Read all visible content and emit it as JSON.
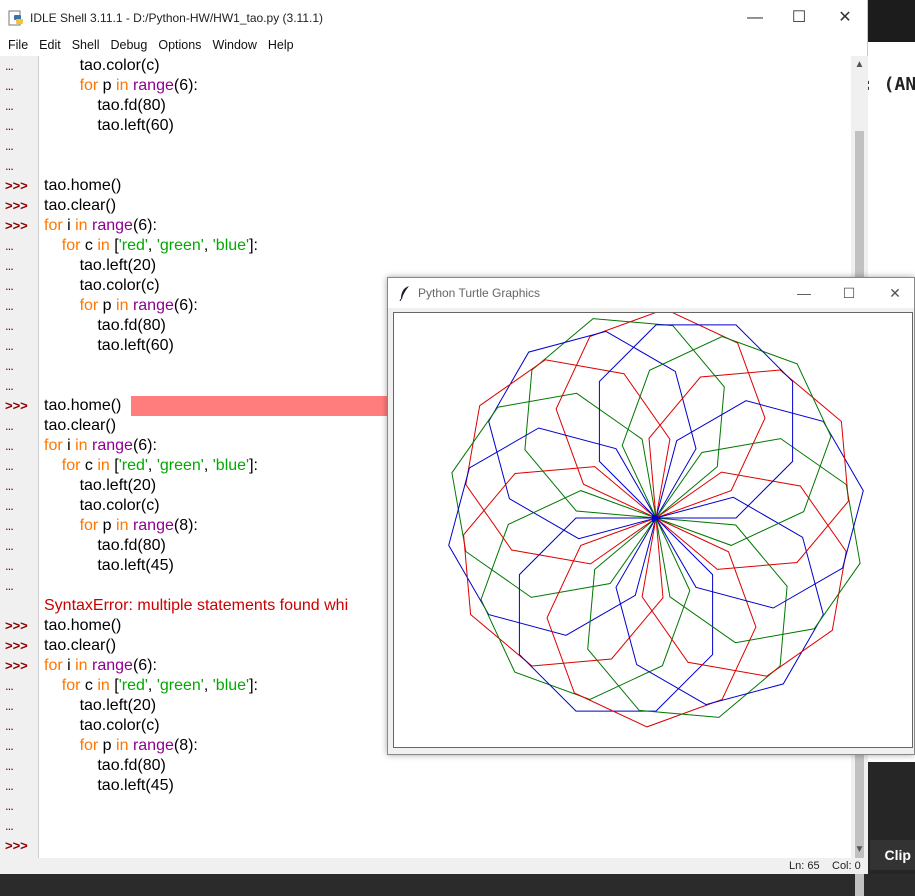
{
  "background": {
    "partial_code_text": ": (AN",
    "clip_button": "Clip"
  },
  "idle": {
    "title": "IDLE Shell 3.11.1 - D:/Python-HW/HW1_tao.py (3.11.1)",
    "menu": [
      "File",
      "Edit",
      "Shell",
      "Debug",
      "Options",
      "Window",
      "Help"
    ],
    "status": {
      "ln": "Ln: 65",
      "col": "Col: 0"
    },
    "gutter": [
      "...",
      "...",
      "...",
      "...",
      "...",
      "...",
      ">>>",
      ">>>",
      ">>>",
      "...",
      "...",
      "...",
      "...",
      "...",
      "...",
      "...",
      "...",
      ">>>",
      "...",
      "...",
      "...",
      "...",
      "...",
      "...",
      "...",
      "...",
      "...",
      "",
      ">>>",
      ">>>",
      ">>>",
      "...",
      "...",
      "...",
      "...",
      "...",
      "...",
      "...",
      "...",
      ">>>"
    ],
    "code": [
      [
        {
          "t": "        tao.color(c)",
          "c": ""
        }
      ],
      [
        {
          "t": "        ",
          "c": ""
        },
        {
          "t": "for",
          "c": "kw"
        },
        {
          "t": " p ",
          "c": ""
        },
        {
          "t": "in",
          "c": "kw"
        },
        {
          "t": " ",
          "c": ""
        },
        {
          "t": "range",
          "c": "bi"
        },
        {
          "t": "(6):",
          "c": ""
        }
      ],
      [
        {
          "t": "            tao.fd(80)",
          "c": ""
        }
      ],
      [
        {
          "t": "            tao.left(60)",
          "c": ""
        }
      ],
      [
        {
          "t": "",
          "c": ""
        }
      ],
      [
        {
          "t": "",
          "c": ""
        }
      ],
      [
        {
          "t": "tao.home()",
          "c": ""
        }
      ],
      [
        {
          "t": "tao.clear()",
          "c": ""
        }
      ],
      [
        {
          "t": "for",
          "c": "kw"
        },
        {
          "t": " i ",
          "c": ""
        },
        {
          "t": "in",
          "c": "kw"
        },
        {
          "t": " ",
          "c": ""
        },
        {
          "t": "range",
          "c": "bi"
        },
        {
          "t": "(6):",
          "c": ""
        }
      ],
      [
        {
          "t": "    ",
          "c": ""
        },
        {
          "t": "for",
          "c": "kw"
        },
        {
          "t": " c ",
          "c": ""
        },
        {
          "t": "in",
          "c": "kw"
        },
        {
          "t": " [",
          "c": ""
        },
        {
          "t": "'red'",
          "c": "str"
        },
        {
          "t": ", ",
          "c": ""
        },
        {
          "t": "'green'",
          "c": "str"
        },
        {
          "t": ", ",
          "c": ""
        },
        {
          "t": "'blue'",
          "c": "str"
        },
        {
          "t": "]:",
          "c": ""
        }
      ],
      [
        {
          "t": "        tao.left(20)",
          "c": ""
        }
      ],
      [
        {
          "t": "        tao.color(c)",
          "c": ""
        }
      ],
      [
        {
          "t": "        ",
          "c": ""
        },
        {
          "t": "for",
          "c": "kw"
        },
        {
          "t": " p ",
          "c": ""
        },
        {
          "t": "in",
          "c": "kw"
        },
        {
          "t": " ",
          "c": ""
        },
        {
          "t": "range",
          "c": "bi"
        },
        {
          "t": "(6):",
          "c": ""
        }
      ],
      [
        {
          "t": "            tao.fd(80)",
          "c": ""
        }
      ],
      [
        {
          "t": "            tao.left(60)",
          "c": ""
        }
      ],
      [
        {
          "t": "",
          "c": ""
        }
      ],
      [
        {
          "t": "",
          "c": ""
        }
      ],
      [
        {
          "t": "tao.home()",
          "c": ""
        }
      ],
      [
        {
          "t": "tao.clear()",
          "c": ""
        }
      ],
      [
        {
          "t": "for",
          "c": "kw"
        },
        {
          "t": " i ",
          "c": ""
        },
        {
          "t": "in",
          "c": "kw"
        },
        {
          "t": " ",
          "c": ""
        },
        {
          "t": "range",
          "c": "bi"
        },
        {
          "t": "(6):",
          "c": ""
        }
      ],
      [
        {
          "t": "    ",
          "c": ""
        },
        {
          "t": "for",
          "c": "kw"
        },
        {
          "t": " c ",
          "c": ""
        },
        {
          "t": "in",
          "c": "kw"
        },
        {
          "t": " [",
          "c": ""
        },
        {
          "t": "'red'",
          "c": "str"
        },
        {
          "t": ", ",
          "c": ""
        },
        {
          "t": "'green'",
          "c": "str"
        },
        {
          "t": ", ",
          "c": ""
        },
        {
          "t": "'blue'",
          "c": "str"
        },
        {
          "t": "]:",
          "c": ""
        }
      ],
      [
        {
          "t": "        tao.left(20)",
          "c": ""
        }
      ],
      [
        {
          "t": "        tao.color(c)",
          "c": ""
        }
      ],
      [
        {
          "t": "        ",
          "c": ""
        },
        {
          "t": "for",
          "c": "kw"
        },
        {
          "t": " p ",
          "c": ""
        },
        {
          "t": "in",
          "c": "kw"
        },
        {
          "t": " ",
          "c": ""
        },
        {
          "t": "range",
          "c": "bi"
        },
        {
          "t": "(8):",
          "c": ""
        }
      ],
      [
        {
          "t": "            tao.fd(80)",
          "c": ""
        }
      ],
      [
        {
          "t": "            tao.left(45)",
          "c": ""
        }
      ],
      [
        {
          "t": "",
          "c": ""
        }
      ],
      [
        {
          "t": "SyntaxError: multiple statements found whi",
          "c": "err"
        }
      ],
      [
        {
          "t": "tao.home()",
          "c": ""
        }
      ],
      [
        {
          "t": "tao.clear()",
          "c": ""
        }
      ],
      [
        {
          "t": "for",
          "c": "kw"
        },
        {
          "t": " i ",
          "c": ""
        },
        {
          "t": "in",
          "c": "kw"
        },
        {
          "t": " ",
          "c": ""
        },
        {
          "t": "range",
          "c": "bi"
        },
        {
          "t": "(6):",
          "c": ""
        }
      ],
      [
        {
          "t": "    ",
          "c": ""
        },
        {
          "t": "for",
          "c": "kw"
        },
        {
          "t": " c ",
          "c": ""
        },
        {
          "t": "in",
          "c": "kw"
        },
        {
          "t": " [",
          "c": ""
        },
        {
          "t": "'red'",
          "c": "str"
        },
        {
          "t": ", ",
          "c": ""
        },
        {
          "t": "'green'",
          "c": "str"
        },
        {
          "t": ", ",
          "c": ""
        },
        {
          "t": "'blue'",
          "c": "str"
        },
        {
          "t": "]:",
          "c": ""
        }
      ],
      [
        {
          "t": "        tao.left(20)",
          "c": ""
        }
      ],
      [
        {
          "t": "        tao.color(c)",
          "c": ""
        }
      ],
      [
        {
          "t": "        ",
          "c": ""
        },
        {
          "t": "for",
          "c": "kw"
        },
        {
          "t": " p ",
          "c": ""
        },
        {
          "t": "in",
          "c": "kw"
        },
        {
          "t": " ",
          "c": ""
        },
        {
          "t": "range",
          "c": "bi"
        },
        {
          "t": "(8):",
          "c": ""
        }
      ],
      [
        {
          "t": "            tao.fd(80)",
          "c": ""
        }
      ],
      [
        {
          "t": "            tao.left(45)",
          "c": ""
        }
      ],
      [
        {
          "t": "",
          "c": ""
        }
      ],
      [
        {
          "t": "",
          "c": ""
        }
      ],
      [
        {
          "t": "",
          "c": ""
        }
      ]
    ]
  },
  "turtle": {
    "title": "Python Turtle Graphics",
    "drawing": {
      "outer_loop": 6,
      "colors": [
        "red",
        "green",
        "blue"
      ],
      "turn_between": 20,
      "polygon_sides": 8,
      "step": 80,
      "turn_in_polygon": 45
    },
    "colors": {
      "red": "#dd0000",
      "green": "#007700",
      "blue": "#0000cc"
    }
  }
}
